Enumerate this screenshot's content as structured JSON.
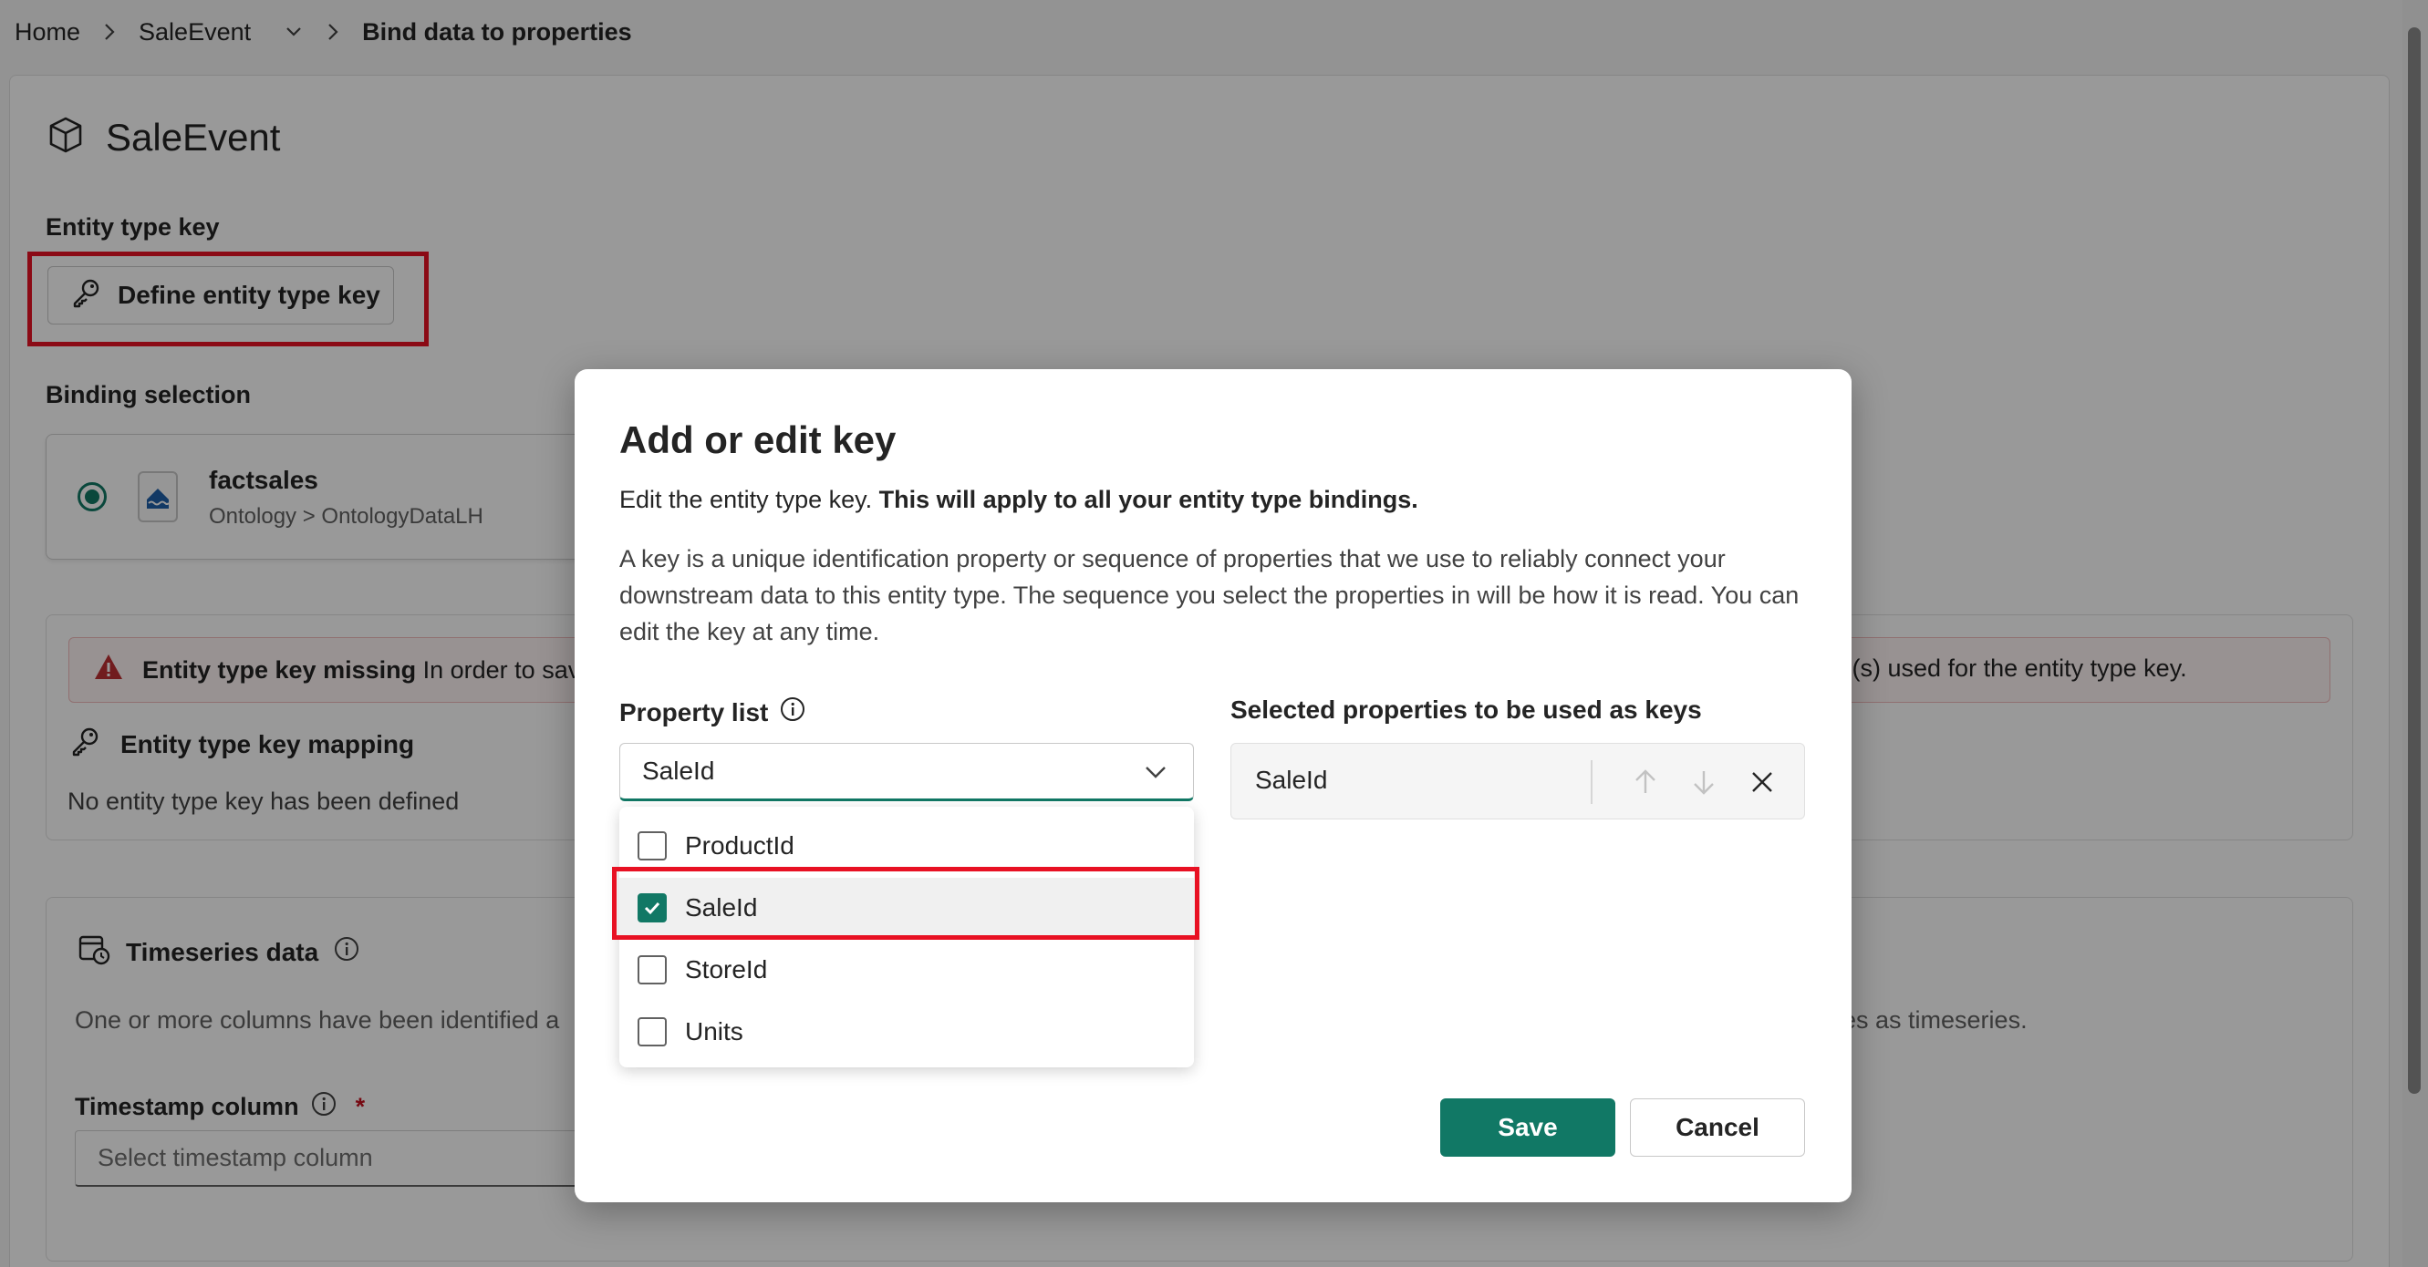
{
  "breadcrumb": {
    "home": "Home",
    "entity": "SaleEvent",
    "current": "Bind data to properties"
  },
  "page": {
    "title": "SaleEvent",
    "entity_type_key_label": "Entity type key",
    "define_key_button": "Define entity type key",
    "binding_selection_label": "Binding selection",
    "binding_card": {
      "title": "factsales",
      "subtitle": "Ontology > OntologyDataLH"
    },
    "warning": {
      "title": "Entity type key missing",
      "text_start": "In order to sav",
      "text_end": "ame(s) used for the entity type key."
    },
    "key_mapping_label": "Entity type key mapping",
    "no_key_text": "No entity type key has been defined",
    "timeseries": {
      "title": "Timeseries data",
      "desc_start": "One or more columns have been identified a",
      "desc_end": "es as timeseries.",
      "timestamp_label": "Timestamp column",
      "required_mark": "*",
      "timestamp_placeholder": "Select timestamp column"
    }
  },
  "dialog": {
    "title": "Add or edit key",
    "intro_normal": "Edit the entity type key. ",
    "intro_bold": "This will apply to all your entity type bindings.",
    "description": "A key is a unique identification property or sequence of properties that we use to reliably connect your downstream data to this entity type. The sequence you select the properties in will be how it is read. You can edit the key at any time.",
    "property_list_label": "Property list",
    "property_list_value": "SaleId",
    "property_options": [
      {
        "label": "ProductId",
        "checked": false
      },
      {
        "label": "SaleId",
        "checked": true
      },
      {
        "label": "StoreId",
        "checked": false
      },
      {
        "label": "Units",
        "checked": false
      }
    ],
    "selected_label": "Selected properties to be used as keys",
    "selected_items": [
      "SaleId"
    ],
    "save_button": "Save",
    "cancel_button": "Cancel"
  },
  "colors": {
    "accent": "#117865",
    "highlight_box": "#e81123",
    "warning_icon": "#bc2f32"
  }
}
